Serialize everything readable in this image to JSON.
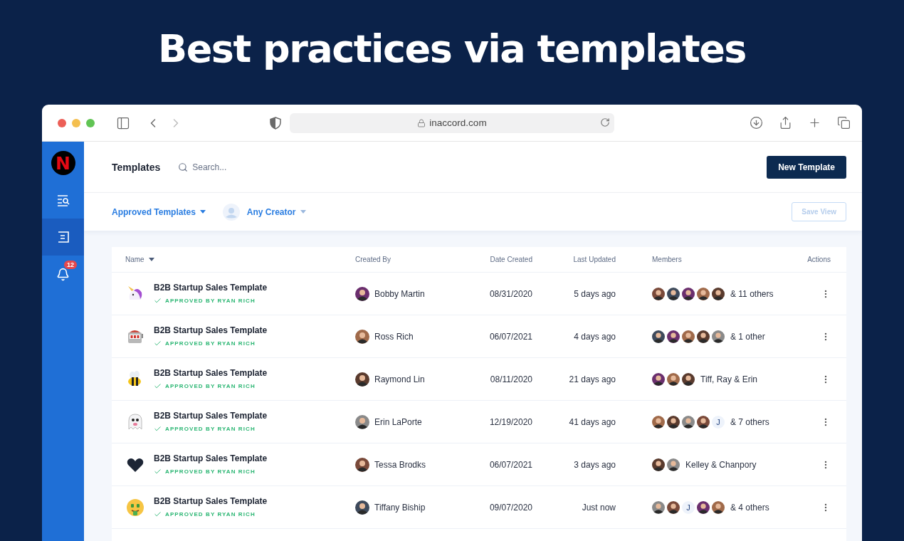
{
  "headline": "Best practices via templates",
  "browser": {
    "url": "inaccord.com"
  },
  "sidebar": {
    "logo": "N",
    "items": [
      {
        "kind": "search-list",
        "selected": false
      },
      {
        "kind": "templates",
        "selected": true
      },
      {
        "kind": "bell",
        "selected": false,
        "badge": "12"
      }
    ]
  },
  "header": {
    "title": "Templates",
    "search": {
      "placeholder": "Search..."
    },
    "new_button": "New Template"
  },
  "filters": {
    "status": "Approved Templates",
    "creator": "Any Creator",
    "save_button": {
      "label": "Save View",
      "disabled": true
    }
  },
  "table": {
    "columns": [
      {
        "label": "Name",
        "sorted": true
      },
      {
        "label": "Created By",
        "sorted": false
      },
      {
        "label": "Date Created",
        "sorted": false
      },
      {
        "label": "Last Updated",
        "sorted": false
      },
      {
        "label": "Members",
        "sorted": false
      },
      {
        "label": "Actions",
        "sorted": false
      }
    ],
    "rows": [
      {
        "kind": "unicorn",
        "name": "B2B Startup Sales Template",
        "approval": "APPROVED BY RYAN RICH",
        "created_by": "Bobby Martin",
        "date_created": "08/31/2020",
        "last_updated": "5 days ago",
        "members": [
          {
            "kind": "photo"
          },
          {
            "kind": "photo"
          },
          {
            "kind": "photo"
          },
          {
            "kind": "photo"
          },
          {
            "kind": "photo"
          }
        ],
        "members_text": "& 11 others"
      },
      {
        "kind": "slot-machine",
        "name": "B2B Startup Sales Template",
        "approval": "APPROVED BY RYAN RICH",
        "created_by": "Ross Rich",
        "date_created": "06/07/2021",
        "last_updated": "4 days ago",
        "members": [
          {
            "kind": "photo"
          },
          {
            "kind": "photo"
          },
          {
            "kind": "photo"
          },
          {
            "kind": "photo"
          },
          {
            "kind": "photo"
          }
        ],
        "members_text": "& 1 other"
      },
      {
        "kind": "bee",
        "name": "B2B Startup Sales Template",
        "approval": "APPROVED BY RYAN RICH",
        "created_by": "Raymond Lin",
        "date_created": "08/11/2020",
        "last_updated": "21 days ago",
        "members": [
          {
            "kind": "photo"
          },
          {
            "kind": "photo"
          },
          {
            "kind": "photo"
          }
        ],
        "members_text": "Tiff, Ray & Erin"
      },
      {
        "kind": "ghost",
        "name": "B2B Startup Sales Template",
        "approval": "APPROVED BY RYAN RICH",
        "created_by": "Erin LaPorte",
        "date_created": "12/19/2020",
        "last_updated": "41 days ago",
        "members": [
          {
            "kind": "photo"
          },
          {
            "kind": "photo"
          },
          {
            "kind": "photo"
          },
          {
            "kind": "photo"
          },
          {
            "kind": "initial",
            "text": "J"
          }
        ],
        "members_text": "& 7 others"
      },
      {
        "kind": "heart",
        "name": "B2B Startup Sales Template",
        "approval": "APPROVED BY RYAN RICH",
        "created_by": "Tessa Brodks",
        "date_created": "06/07/2021",
        "last_updated": "3 days ago",
        "members": [
          {
            "kind": "photo"
          },
          {
            "kind": "photo"
          }
        ],
        "members_text": "Kelley & Chanpory"
      },
      {
        "kind": "money-face",
        "name": "B2B Startup Sales Template",
        "approval": "APPROVED BY RYAN RICH",
        "created_by": "Tiffany Biship",
        "date_created": "09/07/2020",
        "last_updated": "Just now",
        "members": [
          {
            "kind": "photo"
          },
          {
            "kind": "photo"
          },
          {
            "kind": "initial",
            "text": "J"
          },
          {
            "kind": "photo"
          },
          {
            "kind": "photo"
          }
        ],
        "members_text": "& 4 others"
      }
    ]
  }
}
